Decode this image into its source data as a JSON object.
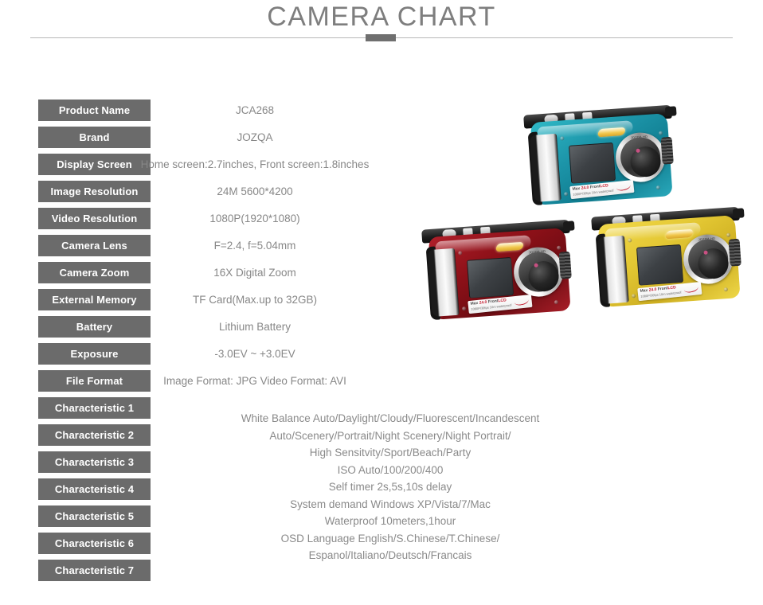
{
  "header": {
    "title": "CAMERA CHART"
  },
  "spec_rows": [
    {
      "label": "Product Name",
      "value": "JCA268"
    },
    {
      "label": "Brand",
      "value": "JOZQA"
    },
    {
      "label": "Display Screen",
      "value": "Home screen:2.7inches, Front screen:1.8inches",
      "wide": true
    },
    {
      "label": "Image Resolution",
      "value": "24M 5600*4200"
    },
    {
      "label": "Video Resolution",
      "value": "1080P(1920*1080)"
    },
    {
      "label": "Camera Lens",
      "value": "F=2.4, f=5.04mm"
    },
    {
      "label": "Camera Zoom",
      "value": "16X Digital Zoom"
    },
    {
      "label": "External Memory",
      "value": "TF Card(Max.up to 32GB)"
    },
    {
      "label": "Battery",
      "value": "Lithium Battery"
    },
    {
      "label": "Exposure",
      "value": "-3.0EV ~ +3.0EV"
    },
    {
      "label": "File Format",
      "value": "Image Format: JPG  Video Format: AVI",
      "wide": true
    },
    {
      "label": "Characteristic 1",
      "value": ""
    },
    {
      "label": "Characteristic 2",
      "value": ""
    },
    {
      "label": "Characteristic 3",
      "value": ""
    },
    {
      "label": "Characteristic 4",
      "value": ""
    },
    {
      "label": "Characteristic 5",
      "value": ""
    },
    {
      "label": "Characteristic 6",
      "value": ""
    },
    {
      "label": "Characteristic 7",
      "value": ""
    }
  ],
  "characteristics_text": [
    "White Balance Auto/Daylight/Cloudy/Fluorescent/Incandescent",
    "Auto/Scenery/Portrait/Night Scenery/Night Portrait/",
    "High Sensitvity/Sport/Beach/Party",
    "ISO Auto/100/200/400",
    "Self timer 2s,5s,10s delay",
    "System demand Windows XP/Vista/7/Mac",
    "Waterproof 10meters,1hour",
    "OSD Language English/S.Chinese/T.Chinese/",
    "Espanol/Italiano/Deutsch/Francais"
  ],
  "product_photo": {
    "cameras": [
      {
        "color_name": "teal",
        "body_color": "#1c94a8",
        "sticker_line1_red": "24.0",
        "sticker_line1_pre": "Max ",
        "sticker_line1_mid": " Front",
        "sticker_line1_post": "LCD",
        "sticker_line2": "1080P/30fps  10m waterproof"
      },
      {
        "color_name": "red",
        "body_color": "#8c1018",
        "sticker_line1_red": "24.0",
        "sticker_line1_pre": "Max ",
        "sticker_line1_mid": " Front",
        "sticker_line1_post": "LCD",
        "sticker_line2": "1080P/30fps  10m waterproof"
      },
      {
        "color_name": "yellow",
        "body_color": "#e3c733",
        "sticker_line1_red": "24.0",
        "sticker_line1_pre": "Max ",
        "sticker_line1_mid": " Front",
        "sticker_line1_post": "LCD",
        "sticker_line2": "1080P/30fps  10m waterproof"
      }
    ],
    "lens_text": "JOZQA HD"
  },
  "colors": {
    "label_chip": "#6b6b6b",
    "label_text": "#ffffff",
    "value_text": "#878787",
    "title_text": "#7e7e7e",
    "rule": "#b9b9b9",
    "rule_center": "#6f6f6f",
    "background": "#ffffff"
  }
}
